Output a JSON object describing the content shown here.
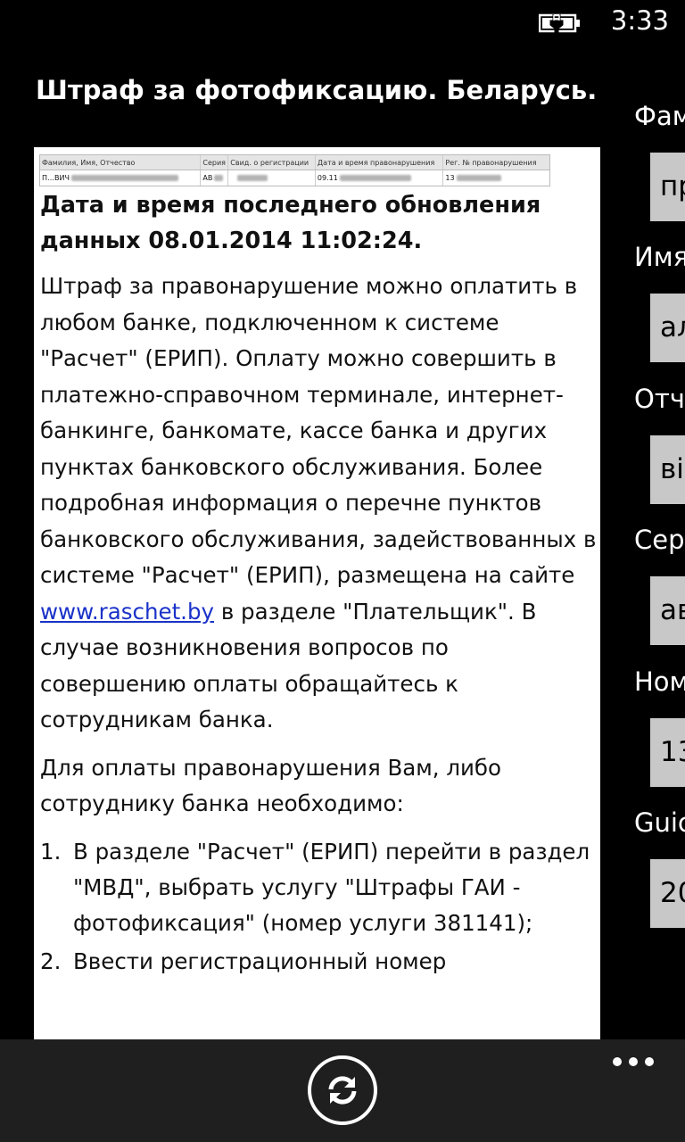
{
  "status": {
    "time": "3:33"
  },
  "page": {
    "title": "Штраф за фотофиксацию. Беларусь."
  },
  "fine_table": {
    "headers": [
      "Фамилия, Имя, Отчество",
      "Серия",
      "Свид. о регистрации",
      "Дата и время правонарушения",
      "Рег. № правонарушения"
    ],
    "values": [
      "П…ВИЧ",
      "АВ",
      "",
      "09.11",
      "13"
    ]
  },
  "content": {
    "update_heading": "Дата и время последнего обновления данных 08.01.2014 11:02:24.",
    "para1_before_link": "Штраф за правонарушение можно оплатить в любом банке, подключенном к системе \"Расчет\" (ЕРИП). Оплату можно совершить в платежно-справочном терминале, интернет-банкинге, банкомате, кассе банка и других пунктах банковского обслуживания. Более подробная информация о перечне пунктов банковского обслуживания, задействованных в системе \"Расчет\" (ЕРИП), размещена на сайте ",
    "link": "www.raschet.by",
    "para1_after_link": " в разделе \"Плательщик\". В случае возникновения вопросов по совершению оплаты обращайтесь к сотрудникам банка.",
    "para2": "Для оплаты правонарушения Вам, либо сотруднику банка необходимо:",
    "steps": [
      {
        "num": "1.",
        "text": "В разделе \"Расчет\" (ЕРИП) перейти в раздел \"МВД\", выбрать услугу \"Штрафы ГАИ - фотофиксация\" (номер услуги 381141);"
      },
      {
        "num": "2.",
        "text": "Ввести регистрационный номер"
      }
    ]
  },
  "side_form": {
    "fields": [
      {
        "label": "Фам",
        "value": "пр"
      },
      {
        "label": "Имя",
        "value": "ал"
      },
      {
        "label": "Отче",
        "value": "ві"
      },
      {
        "label": "Сери",
        "value": "ав"
      },
      {
        "label": "Ном",
        "value": "13"
      },
      {
        "label": "Guic",
        "value": "20"
      }
    ]
  },
  "app_bar": {
    "refresh_icon": "refresh-icon",
    "more_icon": "more-icon"
  }
}
